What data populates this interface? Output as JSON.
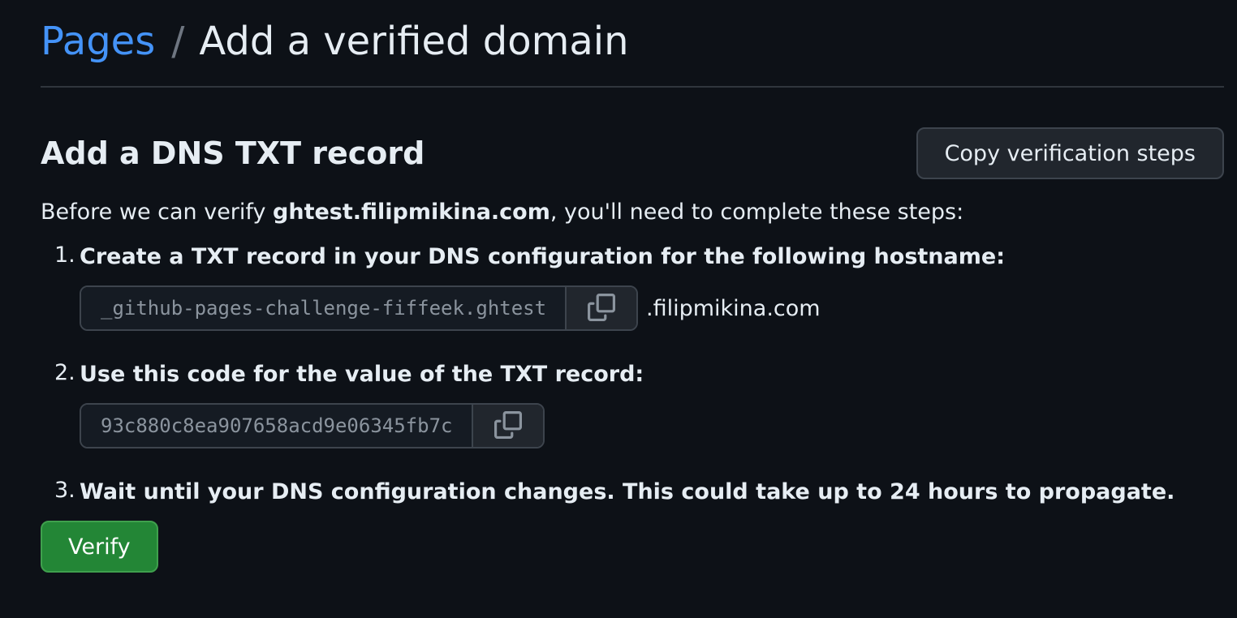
{
  "breadcrumb": {
    "parent": "Pages",
    "separator": "/",
    "current": "Add a verified domain"
  },
  "section": {
    "title": "Add a DNS TXT record",
    "copy_steps_label": "Copy verification steps"
  },
  "intro": {
    "prefix": "Before we can verify ",
    "domain": "ghtest.filipmikina.com",
    "suffix": ", you'll need to complete these steps:"
  },
  "steps": [
    {
      "number": "1.",
      "text": "Create a TXT record in your DNS configuration for the following hostname:",
      "value": "_github-pages-challenge-fiffeek.ghtest",
      "suffix": ".filipmikina.com"
    },
    {
      "number": "2.",
      "text": "Use this code for the value of the TXT record:",
      "value": "93c880c8ea907658acd9e06345fb7c"
    },
    {
      "number": "3.",
      "text": "Wait until your DNS configuration changes. This could take up to 24 hours to propagate."
    }
  ],
  "actions": {
    "verify_label": "Verify"
  },
  "icons": {
    "copy": "copy-icon"
  },
  "colors": {
    "background": "#0d1117",
    "link": "#4493f8",
    "primary_button": "#238636"
  }
}
